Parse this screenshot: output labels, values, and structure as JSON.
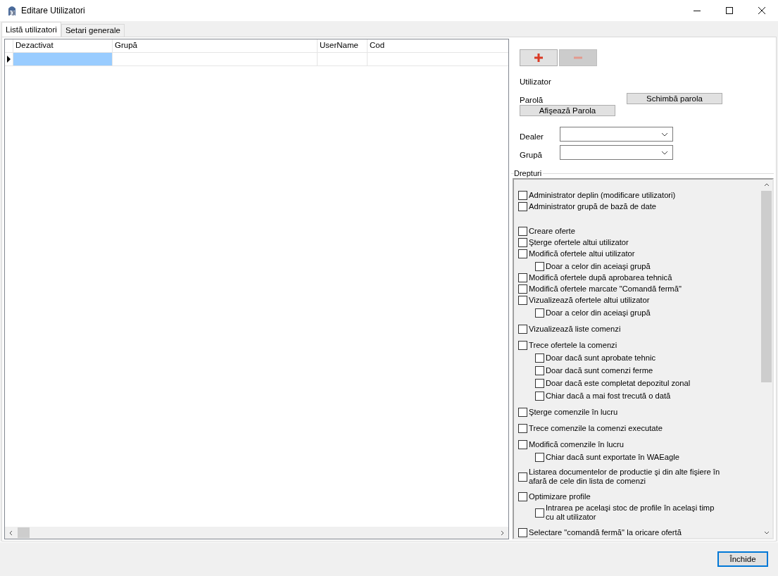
{
  "window": {
    "title": "Editare Utilizatori"
  },
  "tabs": [
    {
      "label": "Listă utilizatori",
      "selected": true
    },
    {
      "label": "Setari generale",
      "selected": false
    }
  ],
  "table": {
    "columns": [
      "Dezactivat",
      "Grupă",
      "UserName",
      "Cod"
    ],
    "rows": [
      {
        "current": true,
        "cells": [
          {
            "selected": true
          },
          {
            "selected": false
          },
          {
            "selected": false
          },
          {
            "selected": false
          }
        ]
      }
    ]
  },
  "toolbar_buttons": [
    {
      "kind": "add",
      "disabled": false
    },
    {
      "kind": "remove",
      "disabled": true
    }
  ],
  "user_label": "Utilizator",
  "password": {
    "label": "Parolă",
    "change_button": "Schimbă parola",
    "show_button": "Afişează Parola"
  },
  "fields": [
    {
      "label": "Dealer"
    },
    {
      "label": "Grupă"
    }
  ],
  "rights": {
    "title": "Drepturi",
    "groups": [
      [
        {
          "label": "Administrator deplin (modificare utilizatori)",
          "checked": false
        },
        {
          "label": "Administrator grupă de bază de date",
          "checked": false
        }
      ],
      [
        {
          "label": "Creare oferte",
          "checked": false
        },
        {
          "label": "Şterge ofertele altui utilizator",
          "checked": false
        },
        {
          "label": "Modifică ofertele altui utilizator",
          "checked": false,
          "children": [
            {
              "label": "Doar a celor din aceiaşi grupă",
              "checked": false
            }
          ]
        },
        {
          "label": "Modifică ofertele după aprobarea tehnică",
          "checked": false
        },
        {
          "label": "Modifică ofertele marcate \"Comandă fermă\"",
          "checked": false
        },
        {
          "label": "Vizualizează ofertele altui utilizator",
          "checked": false,
          "children": [
            {
              "label": "Doar a celor din aceiaşi grupă",
              "checked": false
            }
          ]
        }
      ],
      [
        {
          "label": "Vizualizează liste comenzi",
          "checked": false
        }
      ],
      [
        {
          "label": "Trece ofertele la comenzi",
          "checked": false,
          "children": [
            {
              "label": "Doar dacă sunt aprobate tehnic",
              "checked": false
            },
            {
              "label": "Doar dacă sunt comenzi ferme",
              "checked": false
            },
            {
              "label": "Doar dacă este completat depozitul zonal",
              "checked": false
            },
            {
              "label": "Chiar dacă a mai fost trecută o dată",
              "checked": false
            }
          ]
        }
      ],
      [
        {
          "label": "Şterge comenzile în lucru",
          "checked": false
        }
      ],
      [
        {
          "label": "Trece comenzile la comenzi executate",
          "checked": false
        }
      ],
      [
        {
          "label": "Modifică comenzile în lucru",
          "checked": false,
          "children": [
            {
              "label": "Chiar dacă sunt exportate în WAEagle",
              "checked": false
            }
          ]
        }
      ],
      [
        {
          "label": "Listarea documentelor de productie şi din alte fişiere în afară de cele din lista de comenzi",
          "checked": false
        }
      ],
      [
        {
          "label": "Optimizare profile",
          "checked": false,
          "children": [
            {
              "label": "Intrarea pe acelaşi stoc de profile în acelaşi timp cu alt utilizator",
              "checked": false
            }
          ]
        }
      ],
      [
        {
          "label": "Selectare \"comandă fermă\" la oricare ofertă",
          "checked": false
        }
      ]
    ]
  },
  "close_button": "Închide"
}
